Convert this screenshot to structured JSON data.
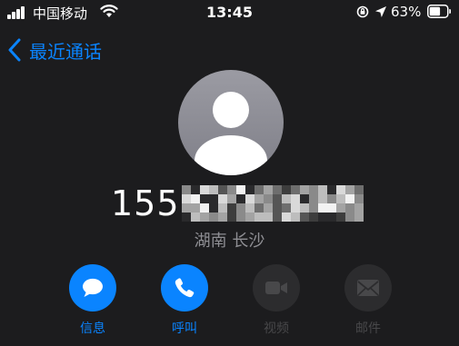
{
  "status_bar": {
    "carrier": "中国移动",
    "time": "13:45",
    "battery_percent": "63%",
    "battery_level": 0.63,
    "icons": [
      "signal-icon",
      "wifi-icon",
      "rotation-lock-icon",
      "location-icon",
      "battery-icon"
    ]
  },
  "nav": {
    "back_label": "最近通话",
    "accent_color": "#0a84ff"
  },
  "contact": {
    "number_visible": "155",
    "number_redacted": true,
    "location": "湖南 长沙"
  },
  "actions": [
    {
      "label": "信息",
      "icon": "message-icon",
      "enabled": true
    },
    {
      "label": "呼叫",
      "icon": "phone-icon",
      "enabled": true
    },
    {
      "label": "视频",
      "icon": "video-icon",
      "enabled": false
    },
    {
      "label": "邮件",
      "icon": "mail-icon",
      "enabled": false
    }
  ]
}
